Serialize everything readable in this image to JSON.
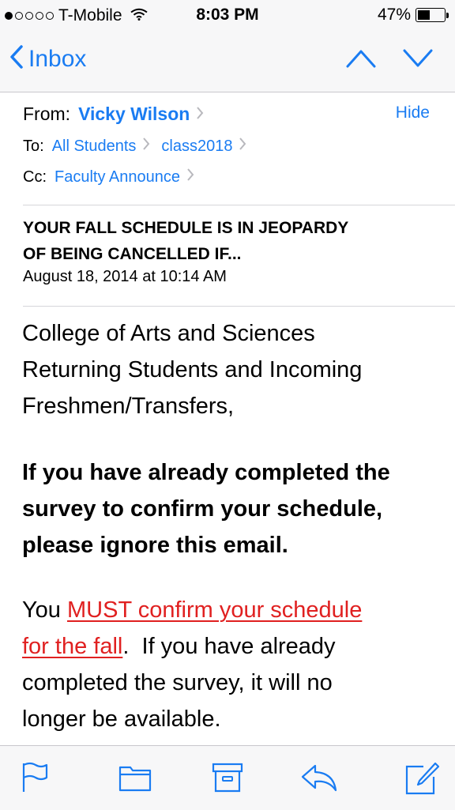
{
  "status_bar": {
    "signal_bars_filled": 1,
    "signal_bars_total": 5,
    "carrier": "T-Mobile",
    "time": "8:03 PM",
    "battery_percent": "47%",
    "battery_level": 0.47,
    "icons": [
      "wifi-icon",
      "battery-icon"
    ]
  },
  "nav": {
    "back_label": "Inbox",
    "icons": [
      "back-chevron-icon",
      "previous-message-icon",
      "next-message-icon"
    ],
    "accent_color": "#1a7cf2"
  },
  "header": {
    "from_label": "From:",
    "from_name": "Vicky Wilson",
    "hide_label": "Hide",
    "to_label": "To:",
    "to_recipients": [
      "All Students",
      "class2018"
    ],
    "cc_label": "Cc:",
    "cc_recipients": [
      "Faculty Announce"
    ]
  },
  "message": {
    "subject_line1": "YOUR FALL SCHEDULE IS IN JEOPARDY",
    "subject_line2": "OF BEING CANCELLED IF...",
    "date": "August 18, 2014 at 10:14 AM",
    "greeting_line1": "College of Arts and Sciences",
    "greeting_line2": "Returning Students and Incoming",
    "greeting_line3": "Freshmen/Transfers,",
    "bold_line1": "If you have already completed the",
    "bold_line2": "survey to confirm your schedule,",
    "bold_line3": "please ignore this email.",
    "para3_prefix": "You ",
    "link_line1": "MUST confirm your schedule",
    "link_line2": "for the fall",
    "para3_after_link": ".  If you have already",
    "para3_line3": "completed the survey, it will no",
    "para3_line4": "longer be available.",
    "link_color": "#e02020"
  },
  "toolbar": {
    "icons": [
      "flag-icon",
      "folder-icon",
      "archive-icon",
      "reply-icon",
      "compose-icon"
    ]
  }
}
